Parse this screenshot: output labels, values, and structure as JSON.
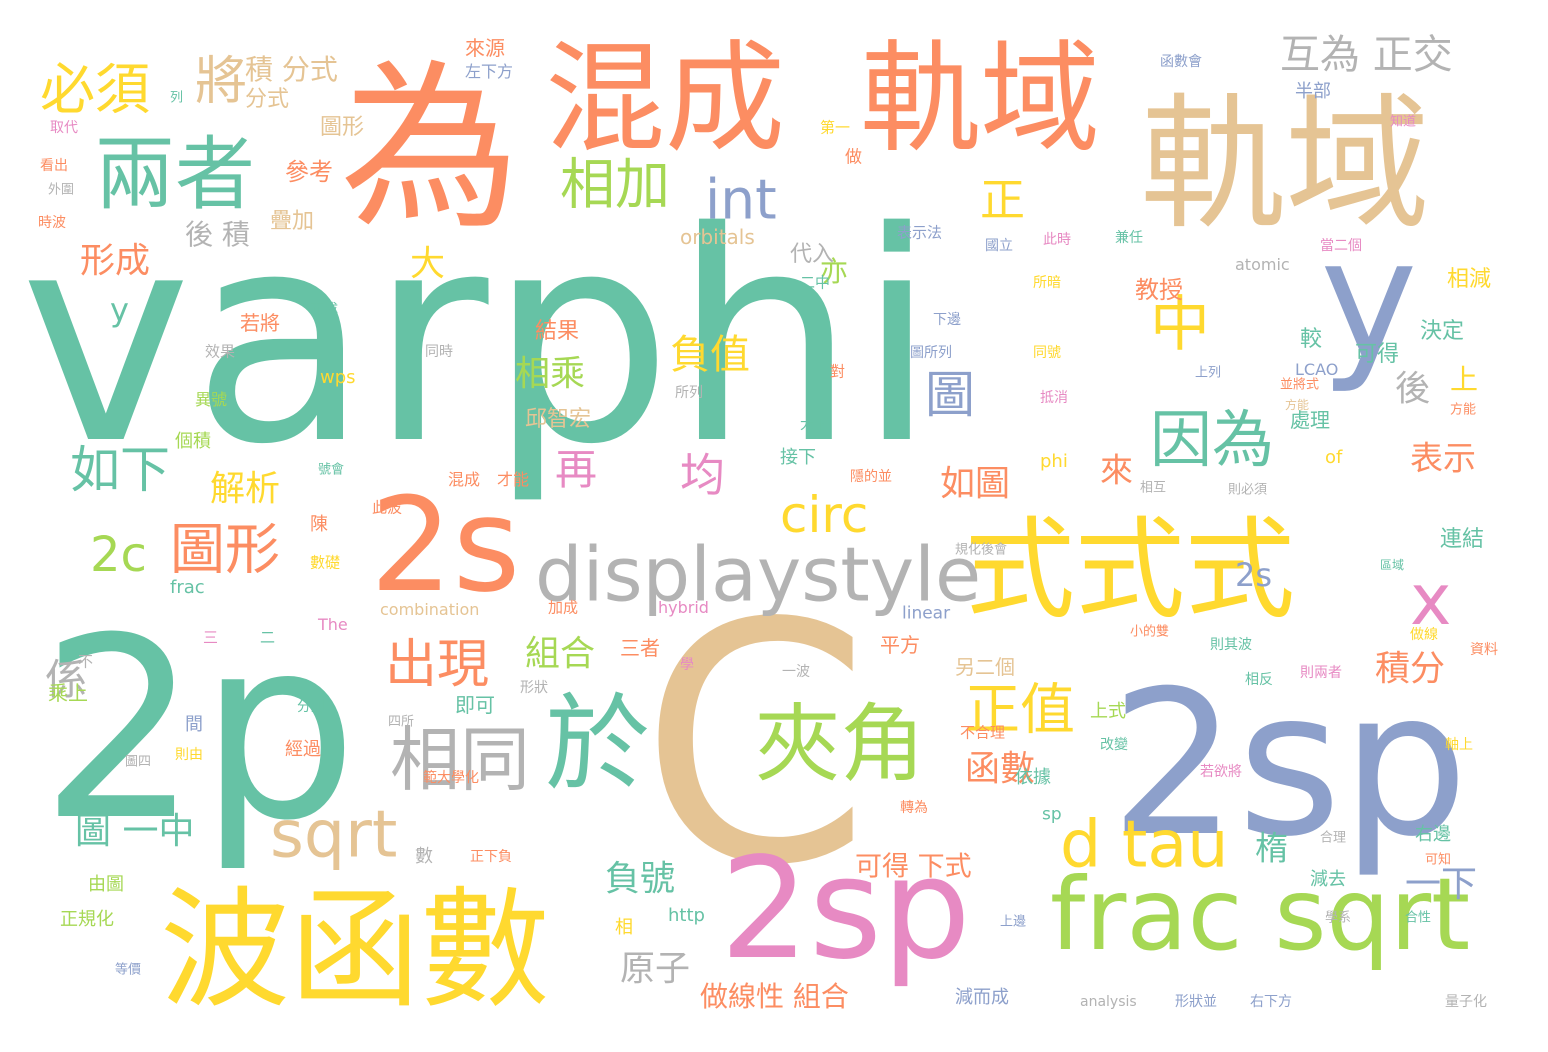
{
  "palette": {
    "teal": "#66c2a5",
    "orange": "#fc8d62",
    "blue": "#8da0cb",
    "pink": "#e78ac3",
    "green": "#a6d854",
    "yellow": "#ffd92f",
    "tan": "#e5c494",
    "gray": "#b3b3b3"
  },
  "words": [
    {
      "text": "varphi",
      "color": "teal"
    },
    {
      "text": "2p",
      "color": "teal"
    },
    {
      "text": "C",
      "color": "tan"
    },
    {
      "text": "2sp",
      "color": "blue"
    },
    {
      "text": "為",
      "color": "orange"
    },
    {
      "text": "混成",
      "color": "orange"
    },
    {
      "text": "軌域",
      "color": "orange"
    },
    {
      "text": "軌域",
      "color": "tan"
    },
    {
      "text": "波函數",
      "color": "yellow"
    },
    {
      "text": "2s",
      "color": "orange"
    },
    {
      "text": "2sp",
      "color": "pink"
    },
    {
      "text": "式式式",
      "color": "yellow"
    },
    {
      "text": "frac sqrt",
      "color": "green"
    },
    {
      "text": "displaystyle",
      "color": "gray"
    },
    {
      "text": "於",
      "color": "teal"
    },
    {
      "text": "夾角",
      "color": "green"
    },
    {
      "text": "兩者",
      "color": "teal"
    },
    {
      "text": "y",
      "color": "blue"
    },
    {
      "text": "x",
      "color": "pink"
    },
    {
      "text": "相同",
      "color": "gray"
    },
    {
      "text": "sqrt",
      "color": "tan"
    },
    {
      "text": "d tau",
      "color": "yellow"
    },
    {
      "text": "因為",
      "color": "teal"
    },
    {
      "text": "中",
      "color": "yellow"
    },
    {
      "text": "相加",
      "color": "green"
    },
    {
      "text": "int",
      "color": "blue"
    },
    {
      "text": "必須",
      "color": "yellow"
    },
    {
      "text": "將",
      "color": "tan"
    },
    {
      "text": "互為 正交",
      "color": "gray"
    },
    {
      "text": "正值",
      "color": "yellow"
    },
    {
      "text": "出現",
      "color": "orange"
    },
    {
      "text": "圖形",
      "color": "orange"
    },
    {
      "text": "circ",
      "color": "yellow"
    },
    {
      "text": "如下",
      "color": "teal"
    },
    {
      "text": "正",
      "color": "yellow"
    },
    {
      "text": "圖",
      "color": "blue"
    },
    {
      "text": "2c",
      "color": "green"
    },
    {
      "text": "均",
      "color": "pink"
    },
    {
      "text": "負值",
      "color": "yellow"
    },
    {
      "text": "再",
      "color": "pink"
    },
    {
      "text": "係",
      "color": "gray"
    },
    {
      "text": "形成",
      "color": "orange"
    },
    {
      "text": "相乘",
      "color": "green"
    },
    {
      "text": "解析",
      "color": "yellow"
    },
    {
      "text": "大",
      "color": "yellow"
    },
    {
      "text": "函數",
      "color": "orange"
    },
    {
      "text": "組合",
      "color": "green"
    },
    {
      "text": "積分",
      "color": "orange"
    },
    {
      "text": "如圖",
      "color": "orange"
    },
    {
      "text": "後",
      "color": "gray"
    },
    {
      "text": "上",
      "color": "yellow"
    },
    {
      "text": "表示",
      "color": "orange"
    },
    {
      "text": "來",
      "color": "orange"
    },
    {
      "text": "2s",
      "color": "blue"
    },
    {
      "text": "圖 一中",
      "color": "teal"
    },
    {
      "text": "負號",
      "color": "teal"
    },
    {
      "text": "一下",
      "color": "blue"
    },
    {
      "text": "原子",
      "color": "gray"
    },
    {
      "text": "可得 下式",
      "color": "orange"
    },
    {
      "text": "楕",
      "color": "teal"
    },
    {
      "text": "做線性 組合",
      "color": "orange"
    },
    {
      "text": "亦",
      "color": "green"
    },
    {
      "text": "y",
      "color": "teal"
    },
    {
      "text": "積 分式",
      "color": "tan"
    },
    {
      "text": "後 積",
      "color": "gray"
    },
    {
      "text": "參考",
      "color": "orange"
    },
    {
      "text": "分式",
      "color": "tan"
    },
    {
      "text": "圖形",
      "color": "tan"
    },
    {
      "text": "疊加",
      "color": "tan"
    },
    {
      "text": "orbitals",
      "color": "tan"
    },
    {
      "text": "代入",
      "color": "gray"
    },
    {
      "text": "教授",
      "color": "orange"
    },
    {
      "text": "結果",
      "color": "orange"
    },
    {
      "text": "若將",
      "color": "orange"
    },
    {
      "text": "邱智宏",
      "color": "tan"
    },
    {
      "text": "wps",
      "color": "yellow"
    },
    {
      "text": "可得",
      "color": "teal"
    },
    {
      "text": "較",
      "color": "teal"
    },
    {
      "text": "處理",
      "color": "teal"
    },
    {
      "text": "決定",
      "color": "teal"
    },
    {
      "text": "相減",
      "color": "yellow"
    },
    {
      "text": "連結",
      "color": "teal"
    },
    {
      "text": "來源",
      "color": "orange"
    },
    {
      "text": "左下方",
      "color": "blue"
    },
    {
      "text": "函數會",
      "color": "blue"
    },
    {
      "text": "半部",
      "color": "blue"
    },
    {
      "text": "atomic",
      "color": "gray"
    },
    {
      "text": "LCAO",
      "color": "blue"
    },
    {
      "text": "phi",
      "color": "yellow"
    },
    {
      "text": "of",
      "color": "yellow"
    },
    {
      "text": "接下",
      "color": "teal"
    },
    {
      "text": "個積",
      "color": "green"
    },
    {
      "text": "異號",
      "color": "green"
    },
    {
      "text": "效果",
      "color": "gray"
    },
    {
      "text": "陳",
      "color": "orange"
    },
    {
      "text": "數礎",
      "color": "yellow"
    },
    {
      "text": "此波",
      "color": "orange"
    },
    {
      "text": "混成",
      "color": "orange"
    },
    {
      "text": "才能",
      "color": "orange"
    },
    {
      "text": "frac",
      "color": "teal"
    },
    {
      "text": "combination",
      "color": "tan"
    },
    {
      "text": "hybrid",
      "color": "pink"
    },
    {
      "text": "linear",
      "color": "blue"
    },
    {
      "text": "The",
      "color": "pink"
    },
    {
      "text": "加成",
      "color": "orange"
    },
    {
      "text": "三者",
      "color": "orange"
    },
    {
      "text": "平方",
      "color": "orange"
    },
    {
      "text": "另二個",
      "color": "tan"
    },
    {
      "text": "即可",
      "color": "teal"
    },
    {
      "text": "乘上",
      "color": "green"
    },
    {
      "text": "上式",
      "color": "green"
    },
    {
      "text": "間",
      "color": "blue"
    },
    {
      "text": "經過",
      "color": "orange"
    },
    {
      "text": "不合理",
      "color": "orange"
    },
    {
      "text": "依據",
      "color": "teal"
    },
    {
      "text": "sp",
      "color": "teal"
    },
    {
      "text": "右邊",
      "color": "teal"
    },
    {
      "text": "減去",
      "color": "teal"
    },
    {
      "text": "正規化",
      "color": "green"
    },
    {
      "text": "由圖",
      "color": "green"
    },
    {
      "text": "http",
      "color": "teal"
    },
    {
      "text": "減而成",
      "color": "blue"
    },
    {
      "text": "analysis",
      "color": "gray"
    },
    {
      "text": "形狀並",
      "color": "blue"
    },
    {
      "text": "右下方",
      "color": "blue"
    },
    {
      "text": "量子化",
      "color": "gray"
    },
    {
      "text": "取代",
      "color": "pink"
    },
    {
      "text": "看出",
      "color": "orange"
    },
    {
      "text": "時波",
      "color": "orange"
    },
    {
      "text": "外圍",
      "color": "gray"
    },
    {
      "text": "列",
      "color": "teal"
    },
    {
      "text": "第一",
      "color": "yellow"
    },
    {
      "text": "做",
      "color": "orange"
    },
    {
      "text": "表示法",
      "color": "blue"
    },
    {
      "text": "國立",
      "color": "blue"
    },
    {
      "text": "此時",
      "color": "pink"
    },
    {
      "text": "兼任",
      "color": "teal"
    },
    {
      "text": "當二個",
      "color": "pink"
    },
    {
      "text": "知道",
      "color": "pink"
    },
    {
      "text": "而成",
      "color": "teal"
    },
    {
      "text": "同時",
      "color": "gray"
    },
    {
      "text": "下邊",
      "color": "blue"
    },
    {
      "text": "圖所列",
      "color": "blue"
    },
    {
      "text": "同號",
      "color": "yellow"
    },
    {
      "text": "抵消",
      "color": "pink"
    },
    {
      "text": "上列",
      "color": "blue"
    },
    {
      "text": "所列",
      "color": "gray"
    },
    {
      "text": "大下",
      "color": "teal"
    },
    {
      "text": "隱的並",
      "color": "orange"
    },
    {
      "text": "相互",
      "color": "gray"
    },
    {
      "text": "則必須",
      "color": "gray"
    },
    {
      "text": "區域",
      "color": "teal"
    },
    {
      "text": "做線",
      "color": "yellow"
    },
    {
      "text": "則其波",
      "color": "teal"
    },
    {
      "text": "資料",
      "color": "orange"
    },
    {
      "text": "相反",
      "color": "teal"
    },
    {
      "text": "則兩者",
      "color": "pink"
    },
    {
      "text": "一波",
      "color": "gray"
    },
    {
      "text": "學",
      "color": "pink"
    },
    {
      "text": "形狀",
      "color": "gray"
    },
    {
      "text": "分別",
      "color": "teal"
    },
    {
      "text": "則由",
      "color": "yellow"
    },
    {
      "text": "圖四",
      "color": "gray"
    },
    {
      "text": "範大學化",
      "color": "orange"
    },
    {
      "text": "改變",
      "color": "teal"
    },
    {
      "text": "轉為",
      "color": "orange"
    },
    {
      "text": "若欲將",
      "color": "pink"
    },
    {
      "text": "軸上",
      "color": "yellow"
    },
    {
      "text": "合理",
      "color": "gray"
    },
    {
      "text": "可知",
      "color": "orange"
    },
    {
      "text": "學系",
      "color": "gray"
    },
    {
      "text": "合性",
      "color": "teal"
    },
    {
      "text": "上邊",
      "color": "blue"
    },
    {
      "text": "等價",
      "color": "blue"
    },
    {
      "text": "相",
      "color": "yellow"
    },
    {
      "text": "數",
      "color": "gray"
    },
    {
      "text": "正下負",
      "color": "orange"
    },
    {
      "text": "不",
      "color": "gray"
    },
    {
      "text": "小的雙",
      "color": "orange"
    },
    {
      "text": "方能",
      "color": "orange"
    },
    {
      "text": "規化後會",
      "color": "gray"
    },
    {
      "text": "四所",
      "color": "gray"
    },
    {
      "text": "三",
      "color": "pink"
    },
    {
      "text": "二",
      "color": "teal"
    },
    {
      "text": "號會",
      "color": "teal"
    },
    {
      "text": "對",
      "color": "orange"
    },
    {
      "text": "二中",
      "color": "teal"
    },
    {
      "text": "所暗",
      "color": "yellow"
    },
    {
      "text": "並將式",
      "color": "orange"
    },
    {
      "text": "方能",
      "color": "tan"
    }
  ]
}
